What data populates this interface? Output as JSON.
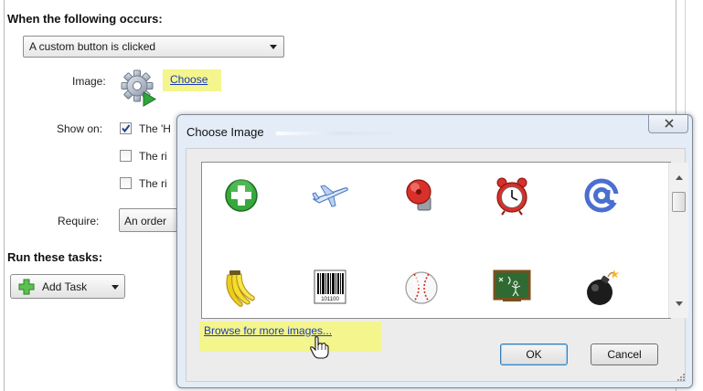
{
  "trigger": {
    "heading": "When the following occurs:",
    "event_select_value": "A custom button is clicked"
  },
  "image_row": {
    "label": "Image:",
    "icon": "gear-play-icon",
    "choose_link": "Choose"
  },
  "show_on": {
    "label": "Show on:",
    "options": [
      {
        "text": "The 'H",
        "checked": true
      },
      {
        "text": "The ri",
        "checked": false
      },
      {
        "text": "The ri",
        "checked": false
      }
    ]
  },
  "require": {
    "label": "Require:",
    "select_value": "An order"
  },
  "tasks": {
    "heading": "Run these tasks:",
    "add_task_label": "Add Task"
  },
  "dialog": {
    "title": "Choose Image",
    "images": [
      "green-plus-icon",
      "airplane-icon",
      "red-alarm-bell-icon",
      "alarm-clock-icon",
      "at-sign-icon",
      "bananas-icon",
      "barcode-icon",
      "baseball-icon",
      "chalkboard-icon",
      "bomb-icon"
    ],
    "barcode_caption": "101100",
    "browse_link": "Browse for more images...",
    "ok_label": "OK",
    "cancel_label": "Cancel"
  },
  "colors": {
    "highlight": "#f4f58c",
    "link": "#1a3bb8",
    "dialog_frame": "#e3ecf7"
  }
}
